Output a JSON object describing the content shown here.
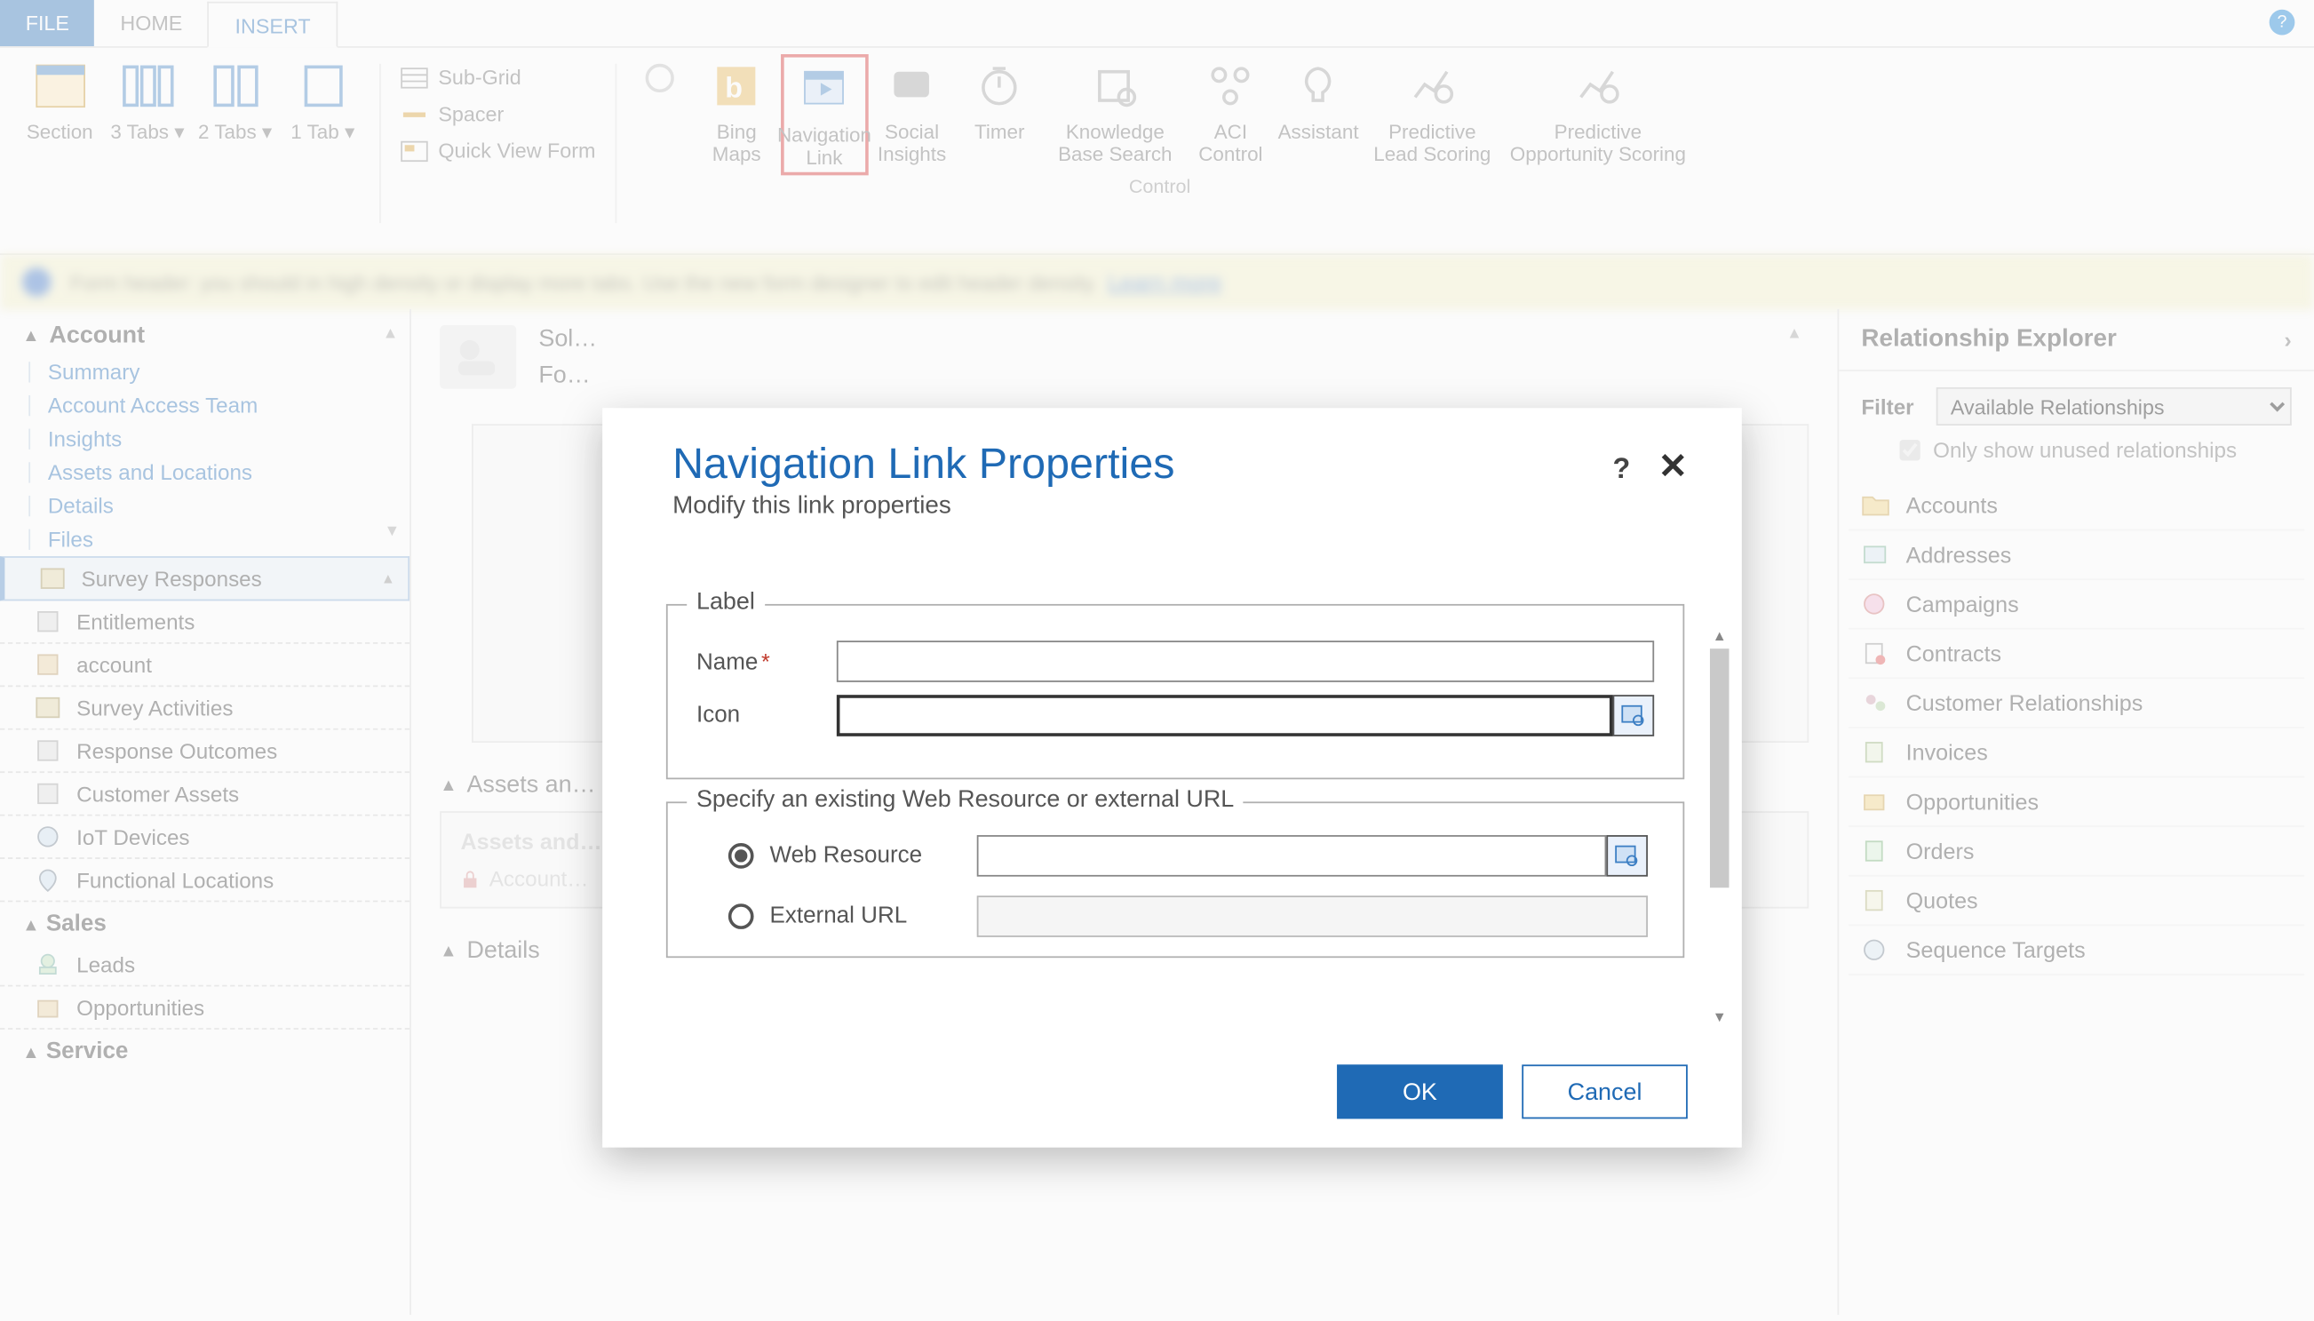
{
  "tabs": {
    "file": "FILE",
    "home": "HOME",
    "insert": "INSERT"
  },
  "ribbon": {
    "section": "Section",
    "tabs3": "3 Tabs ▾",
    "tabs2": "2 Tabs ▾",
    "tabs1": "1 Tab ▾",
    "subgrid": "Sub-Grid",
    "spacer": "Spacer",
    "quickview": "Quick View Form",
    "bing": "Bing Maps",
    "navlink": "Navigation Link",
    "social": "Social Insights",
    "timer": "Timer",
    "kb": "Knowledge Base Search",
    "aci": "ACI Control",
    "assistant": "Assistant",
    "pls": "Predictive Lead Scoring",
    "pos": "Predictive Opportunity Scoring",
    "group_control": "Control"
  },
  "banner": {
    "text": "Form header: you should in high density or display more tabs. Use the new form designer to edit header density.",
    "link": "Learn more"
  },
  "leftnav": {
    "head": "Account",
    "links": [
      "Summary",
      "Account Access Team",
      "Insights",
      "Assets and Locations",
      "Details",
      "Files"
    ],
    "rows": [
      {
        "label": "Survey Responses",
        "active": true
      },
      {
        "label": "Entitlements"
      },
      {
        "label": "account"
      },
      {
        "label": "Survey Activities"
      },
      {
        "label": "Response Outcomes"
      },
      {
        "label": "Customer Assets"
      },
      {
        "label": "IoT Devices"
      },
      {
        "label": "Functional Locations"
      }
    ],
    "sales": "Sales",
    "sales_rows": [
      "Leads",
      "Opportunities"
    ],
    "service": "Service"
  },
  "mid": {
    "sol_label": "Sol…",
    "fo_label": "Fo…",
    "section_assets": "Assets an…",
    "panel_head": "Assets and…",
    "panel_lock": "Account…",
    "section_details": "Details"
  },
  "right": {
    "title": "Relationship Explorer",
    "filter_label": "Filter",
    "filter_value": "Available Relationships",
    "only_unused": "Only show unused relationships",
    "items": [
      "Accounts",
      "Addresses",
      "Campaigns",
      "Contracts",
      "Customer Relationships",
      "Invoices",
      "Opportunities",
      "Orders",
      "Quotes",
      "Sequence Targets"
    ]
  },
  "dialog": {
    "title": "Navigation Link Properties",
    "subtitle": "Modify this link properties",
    "fs_label": "Label",
    "name": "Name",
    "icon": "Icon",
    "fs_url": "Specify an existing Web Resource or external URL",
    "web_resource": "Web Resource",
    "ext_url": "External URL",
    "ok": "OK",
    "cancel": "Cancel"
  }
}
